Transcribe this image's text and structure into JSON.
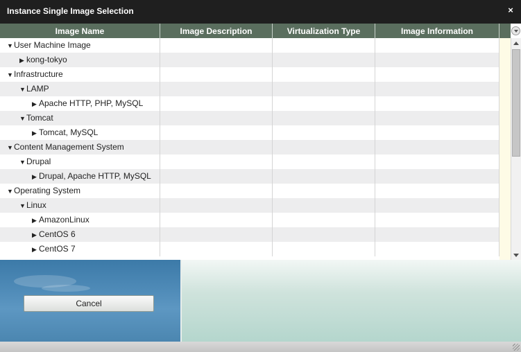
{
  "window": {
    "title": "Instance Single Image Selection",
    "close_label": "×"
  },
  "table": {
    "columns": [
      "Image Name",
      "Image Description",
      "Virtualization Type",
      "Image Information"
    ],
    "rows": [
      {
        "level": 0,
        "expanded": true,
        "label": "User Machine Image"
      },
      {
        "level": 1,
        "expanded": false,
        "label": "kong-tokyo"
      },
      {
        "level": 0,
        "expanded": true,
        "label": "Infrastructure"
      },
      {
        "level": 1,
        "expanded": true,
        "label": "LAMP"
      },
      {
        "level": 2,
        "expanded": false,
        "label": "Apache HTTP, PHP, MySQL"
      },
      {
        "level": 1,
        "expanded": true,
        "label": "Tomcat"
      },
      {
        "level": 2,
        "expanded": false,
        "label": "Tomcat, MySQL"
      },
      {
        "level": 0,
        "expanded": true,
        "label": "Content Management System"
      },
      {
        "level": 1,
        "expanded": true,
        "label": "Drupal"
      },
      {
        "level": 2,
        "expanded": false,
        "label": "Drupal, Apache HTTP, MySQL"
      },
      {
        "level": 0,
        "expanded": true,
        "label": "Operating System"
      },
      {
        "level": 1,
        "expanded": true,
        "label": "Linux"
      },
      {
        "level": 2,
        "expanded": false,
        "label": "AmazonLinux"
      },
      {
        "level": 2,
        "expanded": false,
        "label": "CentOS 6"
      },
      {
        "level": 2,
        "expanded": false,
        "label": "CentOS 7"
      }
    ]
  },
  "footer": {
    "cancel_label": "Cancel"
  },
  "icons": {
    "expanded": "▼",
    "collapsed": "▶"
  },
  "colors": {
    "header_bg": "#5a6e5e",
    "titlebar_bg": "#1f1f1f",
    "row_alt": "#ededee"
  }
}
